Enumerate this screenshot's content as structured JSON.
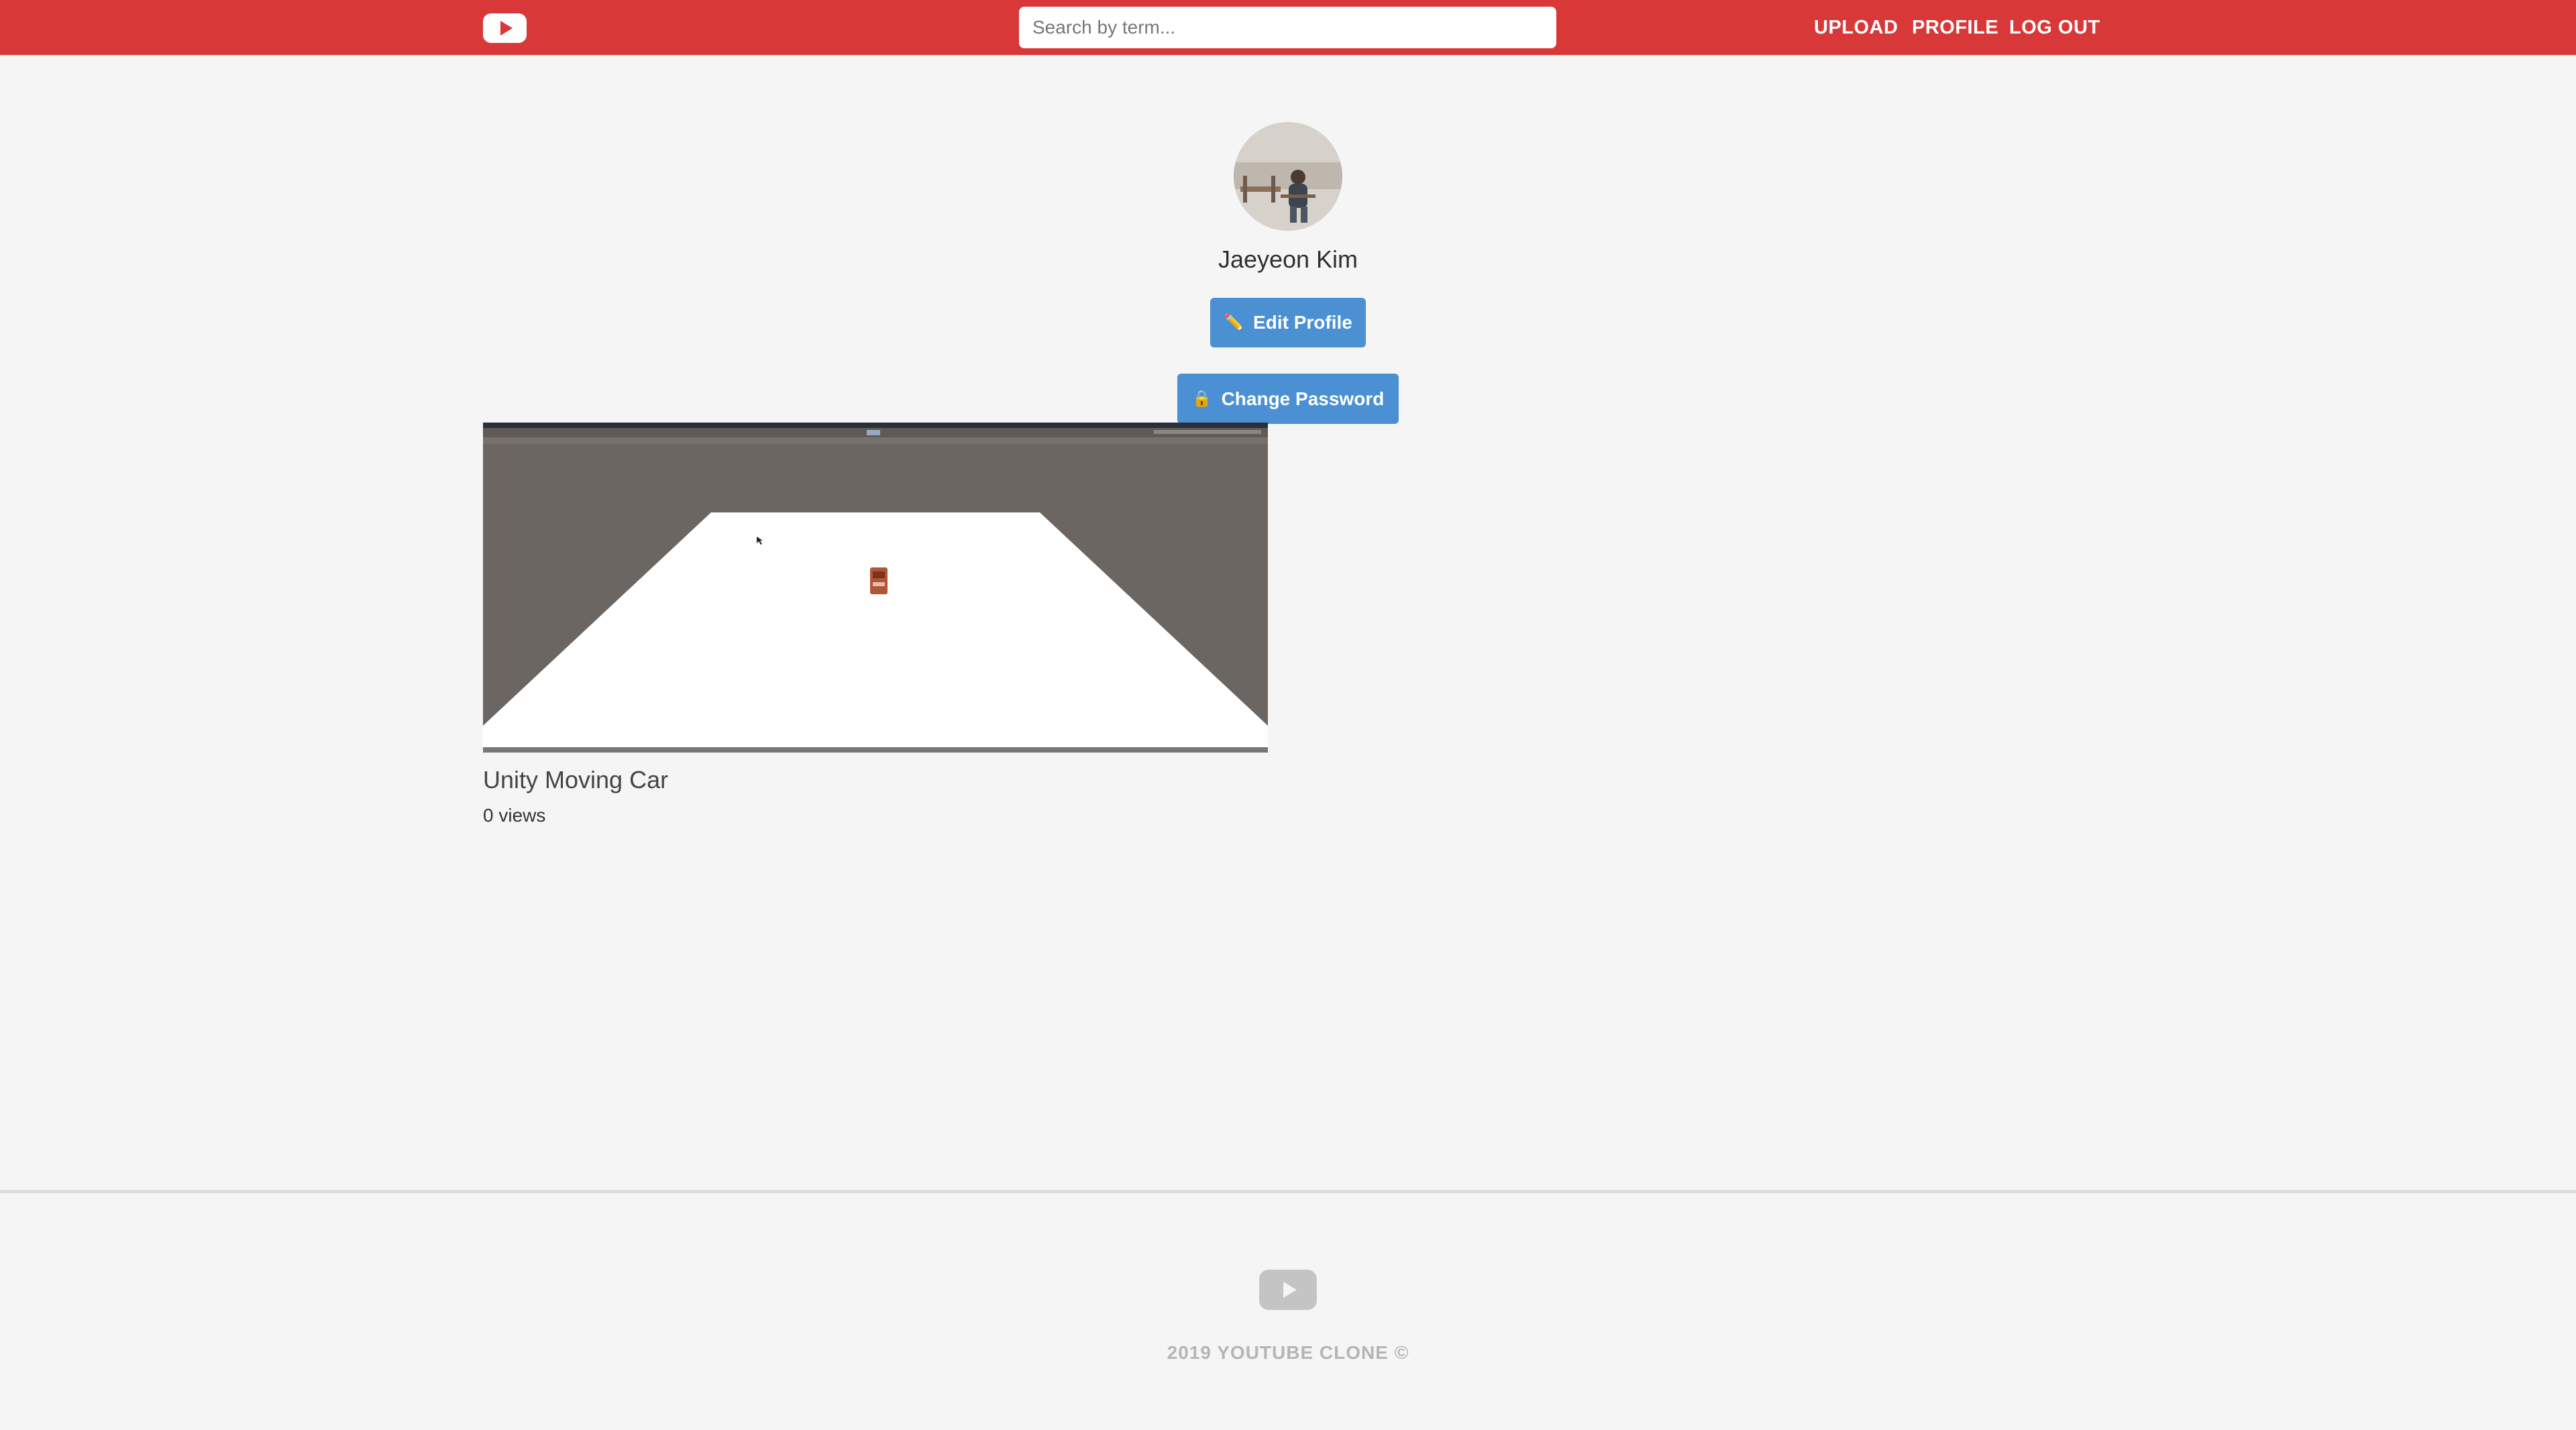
{
  "header": {
    "logo_icon": "youtube-play-icon",
    "search_placeholder": "Search by term...",
    "nav": {
      "upload": "UPLOAD",
      "profile": "PROFILE",
      "logout": "LOG OUT"
    },
    "color": "#d93839"
  },
  "profile": {
    "name": "Jaeyeon Kim",
    "edit_button": "Edit Profile",
    "edit_icon": "pencil-icon",
    "password_button": "Change Password",
    "password_icon": "lock-icon",
    "button_color": "#4a90d3"
  },
  "videos": [
    {
      "title": "Unity Moving Car",
      "views": "0 views"
    }
  ],
  "footer": {
    "logo_icon": "youtube-play-icon",
    "copyright": "2019 YOUTUBE CLONE ©"
  }
}
